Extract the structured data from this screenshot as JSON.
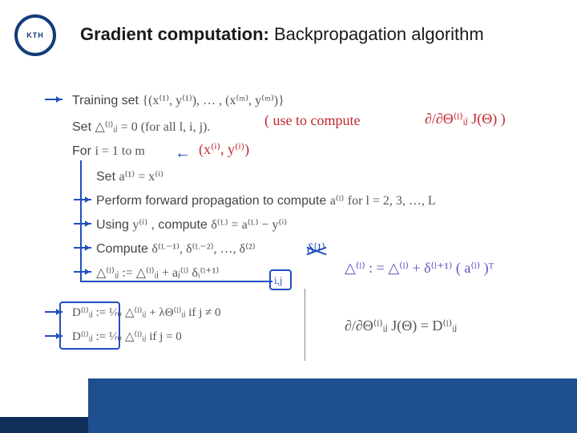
{
  "logo_text": "KTH",
  "title_bold": "Gradient computation:",
  "title_rest": " Backpropagation algorithm",
  "lines": {
    "training": "Training set ",
    "training_math": "{(x⁽¹⁾, y⁽¹⁾), … , (x⁽ᵐ⁾, y⁽ᵐ⁾)}",
    "set_delta": "Set ",
    "set_delta_math": "△⁽ˡ⁾ᵢⱼ = 0  (for all l, i, j).",
    "for": "For ",
    "for_math": "i = 1 to m",
    "set_a": "Set ",
    "set_a_math": "a⁽¹⁾ = x⁽ⁱ⁾",
    "fwd": "Perform forward propagation to compute ",
    "fwd_math": "a⁽ˡ⁾",
    "fwd_tail": " for l = 2, 3, …, L",
    "using": "Using ",
    "using_math_a": "y⁽ⁱ⁾",
    "using_mid": ", compute ",
    "using_math_b": "δ⁽ᴸ⁾ = a⁽ᴸ⁾ − y⁽ⁱ⁾",
    "compute": "Compute ",
    "compute_math": "δ⁽ᴸ⁻¹⁾, δ⁽ᴸ⁻²⁾, …, δ⁽²⁾",
    "update_math": "△⁽ˡ⁾ᵢⱼ := △⁽ˡ⁾ᵢⱼ + aⱼ⁽ˡ⁾ δᵢ⁽ˡ⁺¹⁾",
    "D_if": "D⁽ˡ⁾ᵢⱼ := ¹⁄ₘ △⁽ˡ⁾ᵢⱼ + λΘ⁽ˡ⁾ᵢⱼ   if j ≠ 0",
    "D_else": "D⁽ˡ⁾ᵢⱼ := ¹⁄ₘ △⁽ˡ⁾ᵢⱼ              if j = 0",
    "partial": "∂/∂Θ⁽ˡ⁾ᵢⱼ J(Θ) = D⁽ˡ⁾ᵢⱼ"
  },
  "ann": {
    "use_to": "( use to compute",
    "dJ": "∂/∂Θ⁽ˡ⁾ᵢⱼ J(Θ) )",
    "xiyi": "(x⁽ⁱ⁾, y⁽ⁱ⁾)",
    "no_delta1": "δ⁽¹⁾",
    "delta_vec": "△⁽ˡ⁾ : = △⁽ˡ⁾ + δ⁽ˡ⁺¹⁾ ( a⁽ˡ⁾ )ᵀ",
    "ij": "i,j"
  }
}
